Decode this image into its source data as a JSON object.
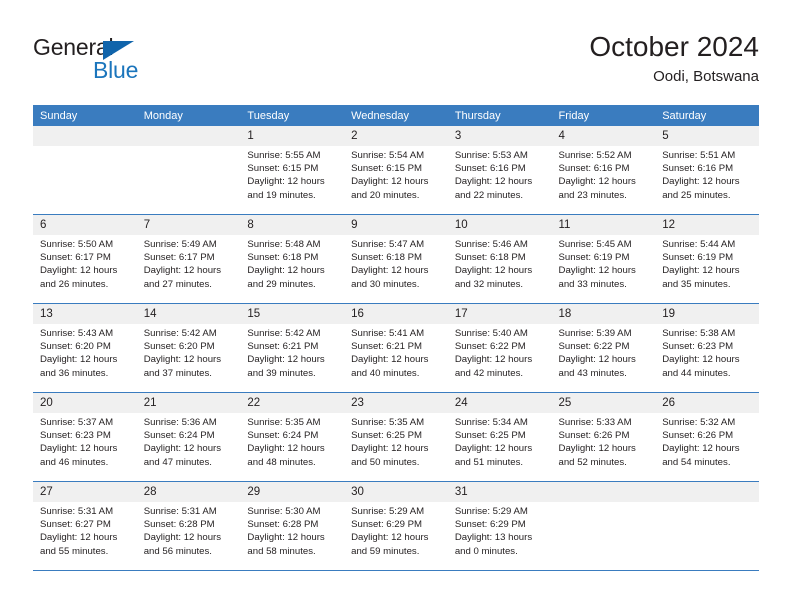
{
  "brand": {
    "name_part1": "General",
    "name_part2": "Blue",
    "colors": {
      "general": "#231f20",
      "blue": "#1b75bc",
      "triangle": "#1064ab"
    }
  },
  "header": {
    "month_title": "October 2024",
    "location": "Oodi, Botswana"
  },
  "calendar": {
    "header_bg": "#3a7cbf",
    "daynum_bg": "#f0f0f0",
    "weekdays": [
      "Sunday",
      "Monday",
      "Tuesday",
      "Wednesday",
      "Thursday",
      "Friday",
      "Saturday"
    ],
    "weeks": [
      [
        {
          "empty": true,
          "day": ""
        },
        {
          "empty": true,
          "day": ""
        },
        {
          "empty": false,
          "day": "1",
          "sunrise": "Sunrise: 5:55 AM",
          "sunset": "Sunset: 6:15 PM",
          "daylight": "Daylight: 12 hours and 19 minutes."
        },
        {
          "empty": false,
          "day": "2",
          "sunrise": "Sunrise: 5:54 AM",
          "sunset": "Sunset: 6:15 PM",
          "daylight": "Daylight: 12 hours and 20 minutes."
        },
        {
          "empty": false,
          "day": "3",
          "sunrise": "Sunrise: 5:53 AM",
          "sunset": "Sunset: 6:16 PM",
          "daylight": "Daylight: 12 hours and 22 minutes."
        },
        {
          "empty": false,
          "day": "4",
          "sunrise": "Sunrise: 5:52 AM",
          "sunset": "Sunset: 6:16 PM",
          "daylight": "Daylight: 12 hours and 23 minutes."
        },
        {
          "empty": false,
          "day": "5",
          "sunrise": "Sunrise: 5:51 AM",
          "sunset": "Sunset: 6:16 PM",
          "daylight": "Daylight: 12 hours and 25 minutes."
        }
      ],
      [
        {
          "empty": false,
          "day": "6",
          "sunrise": "Sunrise: 5:50 AM",
          "sunset": "Sunset: 6:17 PM",
          "daylight": "Daylight: 12 hours and 26 minutes."
        },
        {
          "empty": false,
          "day": "7",
          "sunrise": "Sunrise: 5:49 AM",
          "sunset": "Sunset: 6:17 PM",
          "daylight": "Daylight: 12 hours and 27 minutes."
        },
        {
          "empty": false,
          "day": "8",
          "sunrise": "Sunrise: 5:48 AM",
          "sunset": "Sunset: 6:18 PM",
          "daylight": "Daylight: 12 hours and 29 minutes."
        },
        {
          "empty": false,
          "day": "9",
          "sunrise": "Sunrise: 5:47 AM",
          "sunset": "Sunset: 6:18 PM",
          "daylight": "Daylight: 12 hours and 30 minutes."
        },
        {
          "empty": false,
          "day": "10",
          "sunrise": "Sunrise: 5:46 AM",
          "sunset": "Sunset: 6:18 PM",
          "daylight": "Daylight: 12 hours and 32 minutes."
        },
        {
          "empty": false,
          "day": "11",
          "sunrise": "Sunrise: 5:45 AM",
          "sunset": "Sunset: 6:19 PM",
          "daylight": "Daylight: 12 hours and 33 minutes."
        },
        {
          "empty": false,
          "day": "12",
          "sunrise": "Sunrise: 5:44 AM",
          "sunset": "Sunset: 6:19 PM",
          "daylight": "Daylight: 12 hours and 35 minutes."
        }
      ],
      [
        {
          "empty": false,
          "day": "13",
          "sunrise": "Sunrise: 5:43 AM",
          "sunset": "Sunset: 6:20 PM",
          "daylight": "Daylight: 12 hours and 36 minutes."
        },
        {
          "empty": false,
          "day": "14",
          "sunrise": "Sunrise: 5:42 AM",
          "sunset": "Sunset: 6:20 PM",
          "daylight": "Daylight: 12 hours and 37 minutes."
        },
        {
          "empty": false,
          "day": "15",
          "sunrise": "Sunrise: 5:42 AM",
          "sunset": "Sunset: 6:21 PM",
          "daylight": "Daylight: 12 hours and 39 minutes."
        },
        {
          "empty": false,
          "day": "16",
          "sunrise": "Sunrise: 5:41 AM",
          "sunset": "Sunset: 6:21 PM",
          "daylight": "Daylight: 12 hours and 40 minutes."
        },
        {
          "empty": false,
          "day": "17",
          "sunrise": "Sunrise: 5:40 AM",
          "sunset": "Sunset: 6:22 PM",
          "daylight": "Daylight: 12 hours and 42 minutes."
        },
        {
          "empty": false,
          "day": "18",
          "sunrise": "Sunrise: 5:39 AM",
          "sunset": "Sunset: 6:22 PM",
          "daylight": "Daylight: 12 hours and 43 minutes."
        },
        {
          "empty": false,
          "day": "19",
          "sunrise": "Sunrise: 5:38 AM",
          "sunset": "Sunset: 6:23 PM",
          "daylight": "Daylight: 12 hours and 44 minutes."
        }
      ],
      [
        {
          "empty": false,
          "day": "20",
          "sunrise": "Sunrise: 5:37 AM",
          "sunset": "Sunset: 6:23 PM",
          "daylight": "Daylight: 12 hours and 46 minutes."
        },
        {
          "empty": false,
          "day": "21",
          "sunrise": "Sunrise: 5:36 AM",
          "sunset": "Sunset: 6:24 PM",
          "daylight": "Daylight: 12 hours and 47 minutes."
        },
        {
          "empty": false,
          "day": "22",
          "sunrise": "Sunrise: 5:35 AM",
          "sunset": "Sunset: 6:24 PM",
          "daylight": "Daylight: 12 hours and 48 minutes."
        },
        {
          "empty": false,
          "day": "23",
          "sunrise": "Sunrise: 5:35 AM",
          "sunset": "Sunset: 6:25 PM",
          "daylight": "Daylight: 12 hours and 50 minutes."
        },
        {
          "empty": false,
          "day": "24",
          "sunrise": "Sunrise: 5:34 AM",
          "sunset": "Sunset: 6:25 PM",
          "daylight": "Daylight: 12 hours and 51 minutes."
        },
        {
          "empty": false,
          "day": "25",
          "sunrise": "Sunrise: 5:33 AM",
          "sunset": "Sunset: 6:26 PM",
          "daylight": "Daylight: 12 hours and 52 minutes."
        },
        {
          "empty": false,
          "day": "26",
          "sunrise": "Sunrise: 5:32 AM",
          "sunset": "Sunset: 6:26 PM",
          "daylight": "Daylight: 12 hours and 54 minutes."
        }
      ],
      [
        {
          "empty": false,
          "day": "27",
          "sunrise": "Sunrise: 5:31 AM",
          "sunset": "Sunset: 6:27 PM",
          "daylight": "Daylight: 12 hours and 55 minutes."
        },
        {
          "empty": false,
          "day": "28",
          "sunrise": "Sunrise: 5:31 AM",
          "sunset": "Sunset: 6:28 PM",
          "daylight": "Daylight: 12 hours and 56 minutes."
        },
        {
          "empty": false,
          "day": "29",
          "sunrise": "Sunrise: 5:30 AM",
          "sunset": "Sunset: 6:28 PM",
          "daylight": "Daylight: 12 hours and 58 minutes."
        },
        {
          "empty": false,
          "day": "30",
          "sunrise": "Sunrise: 5:29 AM",
          "sunset": "Sunset: 6:29 PM",
          "daylight": "Daylight: 12 hours and 59 minutes."
        },
        {
          "empty": false,
          "day": "31",
          "sunrise": "Sunrise: 5:29 AM",
          "sunset": "Sunset: 6:29 PM",
          "daylight": "Daylight: 13 hours and 0 minutes."
        },
        {
          "empty": true,
          "day": ""
        },
        {
          "empty": true,
          "day": ""
        }
      ]
    ]
  }
}
